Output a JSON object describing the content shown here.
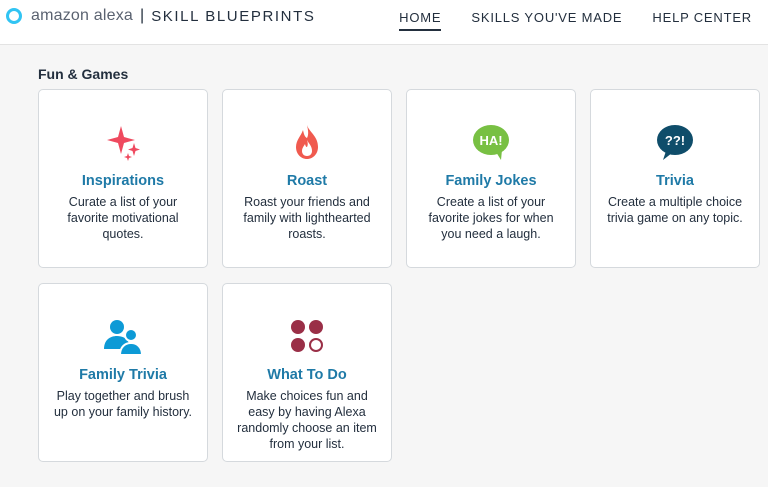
{
  "header": {
    "logo_text": "amazon alexa",
    "separator": "|",
    "product": "SKILL BLUEPRINTS",
    "nav": [
      {
        "label": "HOME",
        "active": true
      },
      {
        "label": "SKILLS YOU'VE MADE",
        "active": false
      },
      {
        "label": "HELP CENTER",
        "active": false
      }
    ]
  },
  "section": {
    "title": "Fun & Games"
  },
  "cards": [
    {
      "title": "Inspirations",
      "description": "Curate a list of your favorite motivational quotes.",
      "icon": "sparkles-icon"
    },
    {
      "title": "Roast",
      "description": "Roast your friends and family with lighthearted roasts.",
      "icon": "flame-icon"
    },
    {
      "title": "Family Jokes",
      "description": "Create a list of your favorite jokes for when you need a laugh.",
      "icon": "ha-speech-bubble-icon",
      "icon_text": "HA!"
    },
    {
      "title": "Trivia",
      "description": "Create a multiple choice trivia game on any topic.",
      "icon": "question-speech-bubble-icon",
      "icon_text": "??!"
    },
    {
      "title": "Family Trivia",
      "description": "Play together and brush up on your family history.",
      "icon": "people-icon"
    },
    {
      "title": "What To Do",
      "description": "Make choices fun and easy by having Alexa randomly choose an item from your list.",
      "icon": "choice-dots-icon"
    }
  ],
  "colors": {
    "alexa_blue": "#31c4f3",
    "title_blue": "#1f7aa7",
    "sparkle_red": "#ef4a5f",
    "flame_red": "#f05a4f",
    "jokes_green": "#78c043",
    "trivia_teal": "#0f4d6a",
    "people_blue": "#0d9ad6",
    "dots_maroon": "#9a2f47"
  }
}
